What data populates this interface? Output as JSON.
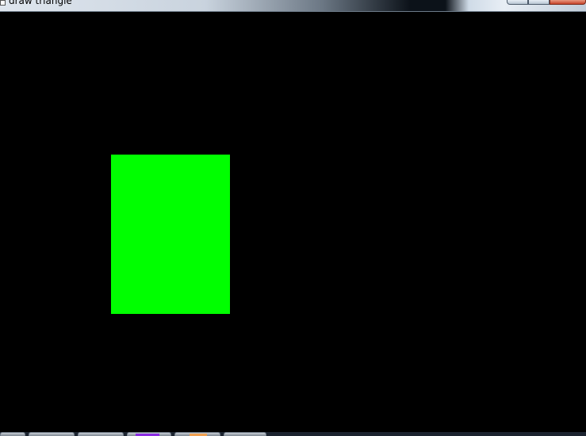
{
  "window": {
    "title": "draw triangle"
  },
  "canvas": {
    "background_color": "#000000",
    "shape_color": "#00ff00"
  },
  "taskbar": {
    "buttons": [
      {
        "name": "taskbar-button-1",
        "accent": ""
      },
      {
        "name": "taskbar-button-2",
        "accent": ""
      },
      {
        "name": "taskbar-button-3",
        "accent": ""
      },
      {
        "name": "taskbar-button-4",
        "accent": "#8a2be2"
      },
      {
        "name": "taskbar-button-5",
        "accent": "#f0a050"
      },
      {
        "name": "taskbar-button-6",
        "accent": ""
      }
    ]
  }
}
